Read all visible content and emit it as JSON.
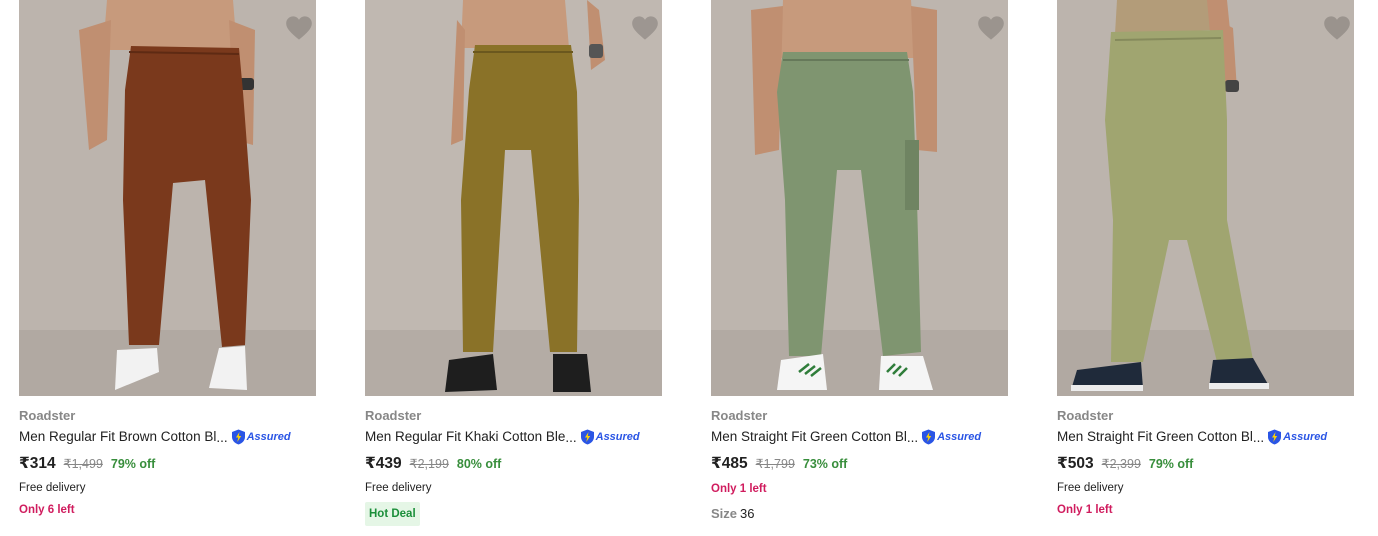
{
  "products": [
    {
      "brand": "Roadster",
      "title": "Men Regular Fit Brown Cotton Bl",
      "assured_label": "Assured",
      "price": "₹314",
      "mrp": "₹1,499",
      "discount": "79% off",
      "delivery": "Free delivery",
      "stock": "Only 6 left",
      "pant_color": "#7a391c",
      "shoe_color": "#f2f2f2"
    },
    {
      "brand": "Roadster",
      "title": "Men Regular Fit Khaki Cotton Ble",
      "assured_label": "Assured",
      "price": "₹439",
      "mrp": "₹2,199",
      "discount": "80% off",
      "delivery": "Free delivery",
      "badge": "Hot Deal",
      "pant_color": "#8a7228",
      "shoe_color": "#1e1e1e"
    },
    {
      "brand": "Roadster",
      "title": "Men Straight Fit Green Cotton Bl",
      "assured_label": "Assured",
      "price": "₹485",
      "mrp": "₹1,799",
      "discount": "73% off",
      "stock": "Only 1 left",
      "size_label": "Size",
      "size_value": "36",
      "pant_color": "#7f9570",
      "shoe_color": "#f5f5f5"
    },
    {
      "brand": "Roadster",
      "title": "Men Straight Fit Green Cotton Bl",
      "assured_label": "Assured",
      "price": "₹503",
      "mrp": "₹2,399",
      "discount": "79% off",
      "delivery": "Free delivery",
      "stock": "Only 1 left",
      "pant_color": "#a0a570",
      "shoe_color": "#1f2a3a"
    }
  ],
  "ellipsis": "..."
}
